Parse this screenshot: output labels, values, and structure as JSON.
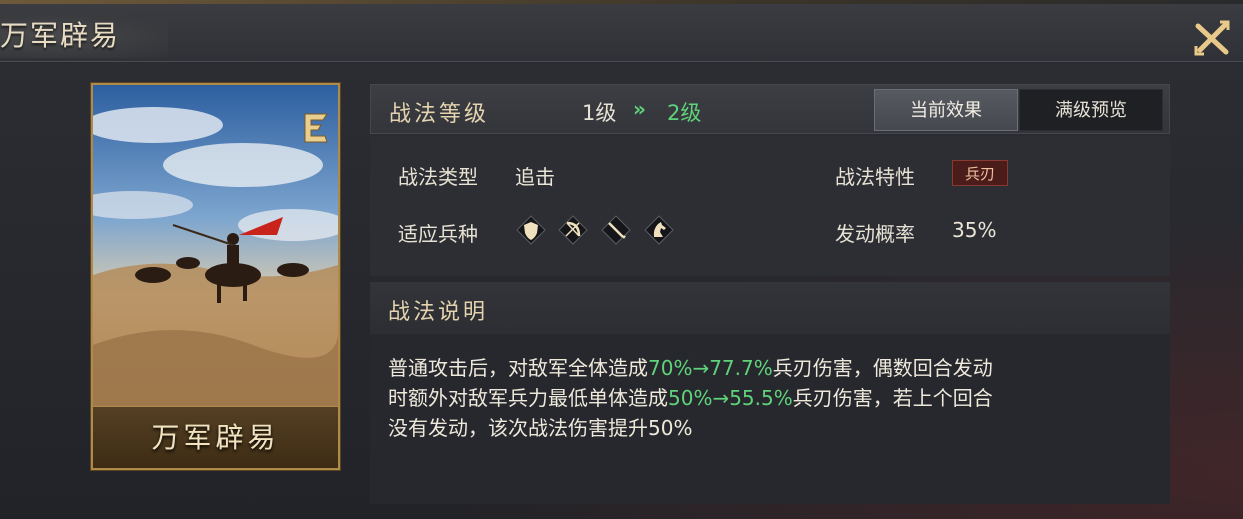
{
  "window": {
    "title": "万军辟易",
    "close_icon": "close-x-icon"
  },
  "card": {
    "name": "万军辟易",
    "badge_icon": "tactic-grade-icon"
  },
  "level": {
    "label": "战法等级",
    "from": "1级",
    "arrow": "»",
    "to": "2级",
    "tabs": [
      "当前效果",
      "满级预览"
    ]
  },
  "info": {
    "type_label": "战法类型",
    "type_value": "追击",
    "trait_label": "战法特性",
    "trait_value": "兵刃",
    "unit_label": "适应兵种",
    "unit_icons": [
      "shield-icon",
      "bow-icon",
      "spear-icon",
      "horse-icon"
    ],
    "chance_label": "发动概率",
    "chance_value": "35%"
  },
  "description": {
    "label": "战法说明",
    "line1_a": "普通攻击后，对敌军全体造成",
    "line1_hl": "70%→77.7%",
    "line1_b": "兵刃伤害，偶数回合发动",
    "line2_a": "时额外对敌军兵力最低单体造成",
    "line2_hl": "50%→55.5%",
    "line2_b": "兵刃伤害，若上个回合",
    "line3": "没有发动，该次战法伤害提升50%"
  },
  "colors": {
    "highlight": "#5fd27a",
    "gold": "#b08a48",
    "trait_bg": "#4a1c1a"
  }
}
